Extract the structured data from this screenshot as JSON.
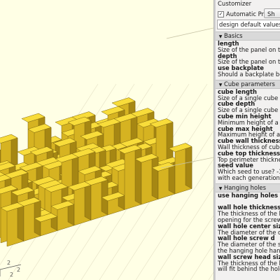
{
  "panel": {
    "title": "Customizer",
    "automatic_preview_label": "Automatic Preview",
    "automatic_preview_checked": true,
    "show_button_label": "Sh",
    "preset_value": "design default values"
  },
  "sections": [
    {
      "title": "Basics",
      "params": [
        {
          "name": "length",
          "desc": [
            "Size of the panel on the x"
          ]
        },
        {
          "name": "depth",
          "desc": [
            "Size of the panel on the y"
          ]
        },
        {
          "name": "use backplate",
          "desc": [
            "Should a backplate be us"
          ]
        }
      ]
    },
    {
      "title": "Cube parameters",
      "params": [
        {
          "name": "cube length",
          "desc": [
            "Size of a single cube on th"
          ]
        },
        {
          "name": "cube depth",
          "desc": [
            "Size of a single cube on th"
          ]
        },
        {
          "name": "cube min height",
          "desc": [
            "Minimum height of a sing"
          ]
        },
        {
          "name": "cube max height",
          "desc": [
            "Maximum height of a sing"
          ]
        },
        {
          "name": "cube wall thickness",
          "desc": [
            "Wall thickness of cube"
          ]
        },
        {
          "name": "cube top thickness",
          "desc": [
            "Top perimeter thickness"
          ]
        },
        {
          "name": "seed value",
          "desc": [
            "Which seed to use? -1 gen",
            "with each generation"
          ]
        }
      ]
    },
    {
      "title": "Hanging holes",
      "params": [
        {
          "name": "use hanging holes",
          "desc": []
        },
        {
          "name": "wall hole thickness",
          "desc": [
            "The thickness of the base",
            "opening for the screw/na"
          ]
        },
        {
          "name": "wall hole center size",
          "desc": [
            "The diameter of the cente"
          ]
        },
        {
          "name": "wall hole screw d",
          "desc": [
            "The diameter of the screw",
            "the hanging hole handles"
          ]
        },
        {
          "name": "wall screw head size",
          "desc": [
            "The thickness of the head",
            "will fit behind the hole"
          ]
        }
      ]
    }
  ],
  "viewport": {
    "axis_labels": [
      "2",
      "2",
      "2"
    ],
    "model_colors": {
      "top": "#f8dc3a",
      "front": "#d6b321",
      "side": "#a68713",
      "background": "#ffffe5"
    }
  }
}
